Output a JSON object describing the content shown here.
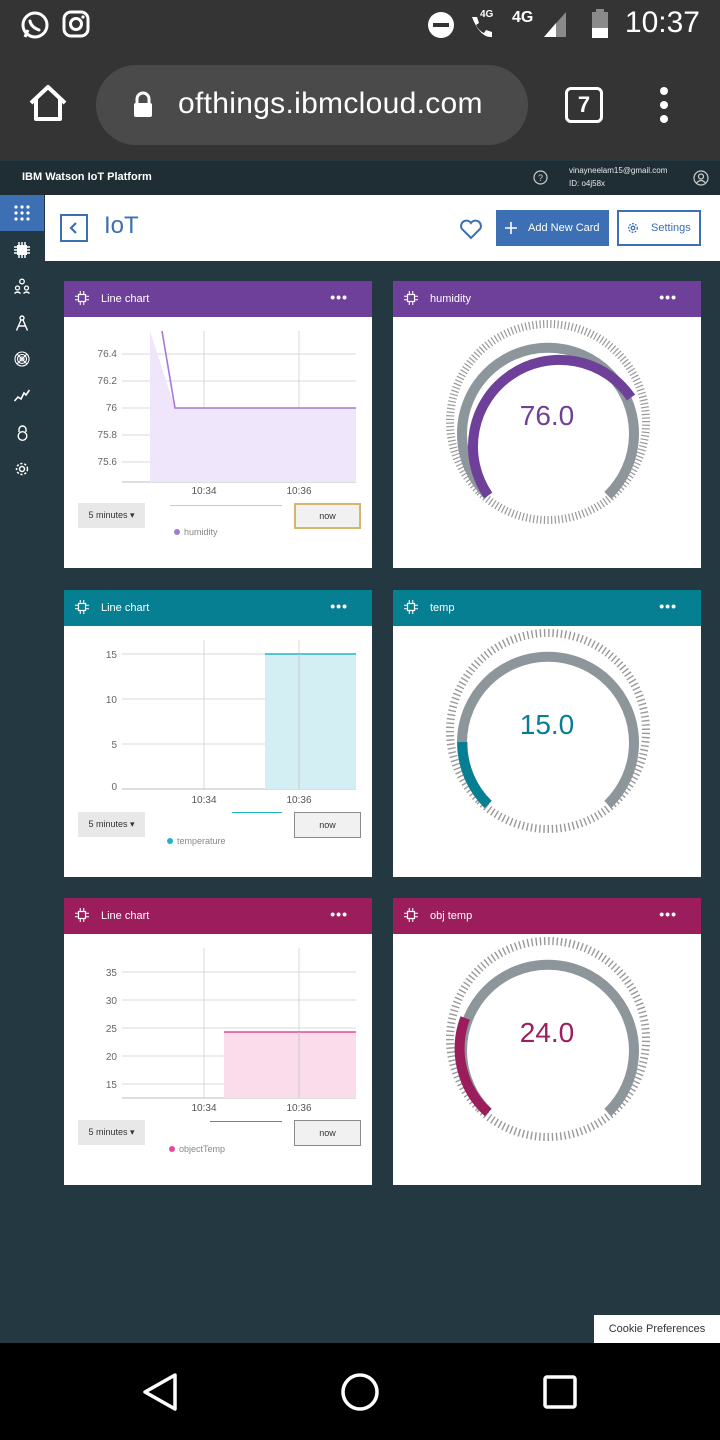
{
  "status_bar": {
    "time": "10:37",
    "network_left": "4G",
    "network_right": "4G"
  },
  "browser": {
    "url": "ofthings.ibmcloud.com",
    "tab_count": "7"
  },
  "ibm_header": {
    "title": "IBM Watson IoT Platform",
    "user_email": "vinayneelam15@gmail.com",
    "user_id": "ID: o4j58x"
  },
  "page": {
    "title": "IoT",
    "add_card_label": "Add New Card",
    "settings_label": "Settings"
  },
  "colors": {
    "purple": "#6f4099",
    "teal": "#077f92",
    "magenta": "#9c1d5c",
    "gauge_track": "#8d969b",
    "accent": "#3d6fb5"
  },
  "cards": {
    "c1": {
      "title": "Line chart",
      "range": "5 minutes ▾",
      "now": "now",
      "legend": "humidity"
    },
    "c2": {
      "title": "humidity",
      "value": "76.0"
    },
    "c3": {
      "title": "Line chart",
      "range": "5 minutes ▾",
      "now": "now",
      "legend": "temperature"
    },
    "c4": {
      "title": "temp",
      "value": "15.0"
    },
    "c5": {
      "title": "Line chart",
      "range": "5 minutes ▾",
      "now": "now",
      "legend": "objectTemp"
    },
    "c6": {
      "title": "obj temp",
      "value": "24.0"
    }
  },
  "chart_data": [
    {
      "type": "area",
      "series": [
        {
          "name": "humidity",
          "points": [
            [
              "10:33:24",
              76.56
            ],
            [
              "10:33:39",
              75.98
            ],
            [
              "10:37:00",
              75.98
            ]
          ]
        }
      ],
      "y_ticks": [
        "76.4",
        "76.2",
        "76",
        "75.8",
        "75.6"
      ],
      "x_ticks": [
        "10:34",
        "10:36"
      ],
      "color": "#a678d6"
    },
    {
      "type": "area",
      "series": [
        {
          "name": "temperature",
          "points": [
            [
              "10:35:20",
              15
            ],
            [
              "10:37:00",
              15
            ]
          ]
        }
      ],
      "y_ticks": [
        "15",
        "10",
        "5",
        "0"
      ],
      "x_ticks": [
        "10:34",
        "10:36"
      ],
      "ylim": [
        0,
        15
      ],
      "color": "#1fb5c9"
    },
    {
      "type": "area",
      "series": [
        {
          "name": "objectTemp",
          "points": [
            [
              "10:34:25",
              24
            ],
            [
              "10:37:00",
              24
            ]
          ]
        }
      ],
      "y_ticks": [
        "35",
        "30",
        "25",
        "20",
        "15"
      ],
      "x_ticks": [
        "10:34",
        "10:36"
      ],
      "color": "#e8489a"
    },
    {
      "type": "gauge",
      "label": "humidity",
      "value": 76.0,
      "fill_fraction": 0.76
    },
    {
      "type": "gauge",
      "label": "temp",
      "value": 15.0,
      "fill_fraction": 0.15
    },
    {
      "type": "gauge",
      "label": "obj temp",
      "value": 24.0,
      "fill_fraction": 0.24
    }
  ],
  "cookie": {
    "label": "Cookie Preferences"
  }
}
